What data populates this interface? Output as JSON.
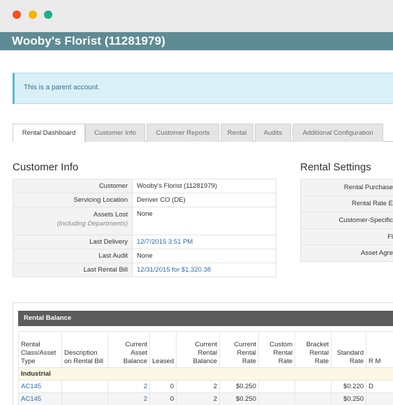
{
  "window": {
    "title": "Wooby's Florist (11281979)"
  },
  "alert": {
    "text": "This is a parent account."
  },
  "tabs": [
    {
      "label": "Rental Dashboard",
      "active": true
    },
    {
      "label": "Customer Info"
    },
    {
      "label": "Customer Reports"
    },
    {
      "label": "Rental"
    },
    {
      "label": "Audits"
    },
    {
      "label": "Additional Configuration"
    }
  ],
  "customer_info": {
    "title": "Customer Info",
    "rows": [
      {
        "label": "Customer",
        "value": "Wooby's Florist (11281979)"
      },
      {
        "label": "Servicing Location",
        "value": "Denver CO (DE)"
      },
      {
        "label": "Assets Lost",
        "sublabel": "(Including Departments)",
        "value": "None"
      },
      {
        "label": "Last Delivery",
        "value": "12/7/2015 3:51 PM"
      },
      {
        "label": "Last Audit",
        "value": "None"
      },
      {
        "label": "Last Rental Bill",
        "value": "12/31/2015 for $1,320.38"
      }
    ]
  },
  "rental_settings": {
    "title": "Rental Settings",
    "rows": [
      "Rental Purchase",
      "Rental Rate E",
      "Customer-Specific",
      "Fl",
      "Asset Agre"
    ]
  },
  "rental_balance": {
    "title": "Rental Balance",
    "headers": [
      "Rental Class/Asset Type",
      "Description on Rental Bill",
      "Current Asset Balance",
      "Leased",
      "Current Rental Balance",
      "Current Rental Rate",
      "Custom Rental Rate",
      "Bracket Rental Rate",
      "Standard Rate",
      "R M"
    ],
    "group": "Industrial",
    "rows": [
      {
        "type": "AC145",
        "desc": "",
        "asset_balance": "2",
        "leased": "0",
        "rental_balance": "2",
        "current_rate": "$0.250",
        "custom_rate": "",
        "bracket_rate": "",
        "standard_rate": "$0.220",
        "extra": "D"
      },
      {
        "type": "AC145",
        "desc": "",
        "asset_balance": "2",
        "leased": "0",
        "rental_balance": "2",
        "current_rate": "$0.250",
        "custom_rate": "",
        "bracket_rate": "",
        "standard_rate": "$0.250",
        "extra": ""
      }
    ]
  },
  "colors": {
    "titlebar": "#5e8b94",
    "alert_bg": "#d9f0f7",
    "panel_head": "#5c5c5c",
    "link": "#2a6fb0",
    "group_row": "#fcf8e3"
  }
}
